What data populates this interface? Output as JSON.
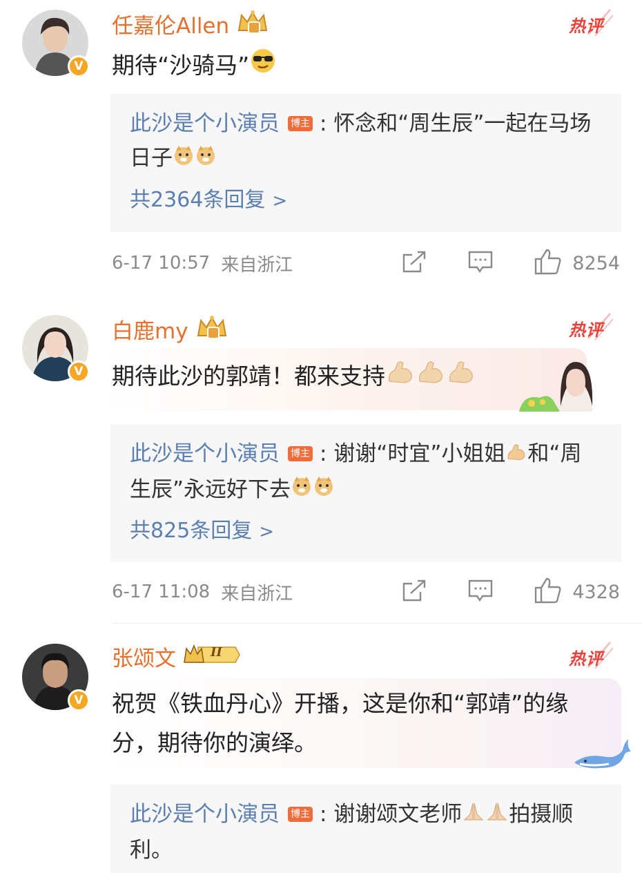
{
  "comments": [
    {
      "name": "任嘉伦Allen",
      "verified_mark": "V",
      "hot_label": "热评",
      "text": "期待“沙骑马”",
      "reply": {
        "author": "此沙是个小演员",
        "badge": "博主",
        "text": ": 怀念和“周生辰”一起在马场日子",
        "count_label": "共2364条回复",
        "chevron": ">"
      },
      "time": "6-17 10:57",
      "location": "来自浙江",
      "likes": "8254"
    },
    {
      "name": "白鹿my",
      "verified_mark": "V",
      "hot_label": "热评",
      "text": "期待此沙的郭靖！都来支持",
      "reply": {
        "author": "此沙是个小演员",
        "badge": "博主",
        "text": ": 谢谢“时宜”小姐姐",
        "text2": "和“周生辰”永远好下去",
        "count_label": "共825条回复",
        "chevron": ">"
      },
      "time": "6-17 11:08",
      "location": "来自浙江",
      "likes": "4328"
    },
    {
      "name": "张颂文",
      "verified_mark": "V",
      "level_badge": "II",
      "hot_label": "热评",
      "text": "祝贺《铁血丹心》开播，这是你和“郭靖”的缘分，期待你的演绎。",
      "reply": {
        "author": "此沙是个小演员",
        "badge": "博主",
        "text": ": 谢谢颂文老师",
        "text2": "拍摄顺利。"
      }
    }
  ],
  "icons": {
    "share": "share-icon",
    "comment": "comment-icon",
    "like": "thumbs-up-icon",
    "crown": "crown-icon",
    "emoji_cool": "sunglasses-emoji-icon",
    "emoji_doge": "doge-emoji-icon",
    "emoji_muscle": "muscle-emoji-icon",
    "emoji_pray": "pray-emoji-icon"
  },
  "colors": {
    "name": "#e6702e",
    "link": "#5b7fb0",
    "hot": "#e8433b",
    "host_badge": "#f26b3a",
    "verified": "#f5a623"
  }
}
